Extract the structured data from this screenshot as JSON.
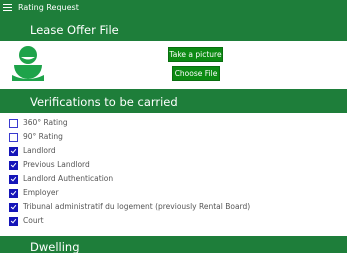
{
  "window": {
    "title": "Rating Request"
  },
  "lease_offer": {
    "header": "Lease Offer File",
    "take_picture_label": "Take a picture",
    "choose_file_label": "Choose File"
  },
  "verifications": {
    "header": "Verifications to be carried",
    "items": [
      {
        "label": "360° Rating",
        "checked": false
      },
      {
        "label": "90° Rating",
        "checked": false
      },
      {
        "label": "Landlord",
        "checked": true
      },
      {
        "label": "Previous Landlord",
        "checked": true
      },
      {
        "label": "Landlord Authentication",
        "checked": true
      },
      {
        "label": "Employer",
        "checked": true
      },
      {
        "label": "Tribunal administratif du logement (previously Rental Board)",
        "checked": true
      },
      {
        "label": "Court",
        "checked": true
      }
    ]
  },
  "dwelling": {
    "header": "Dwelling"
  },
  "colors": {
    "header_green": "#1e7e3a",
    "button_green": "#0c8a13",
    "avatar_green": "#1ea34a",
    "checkbox_blue": "#1515b8"
  }
}
